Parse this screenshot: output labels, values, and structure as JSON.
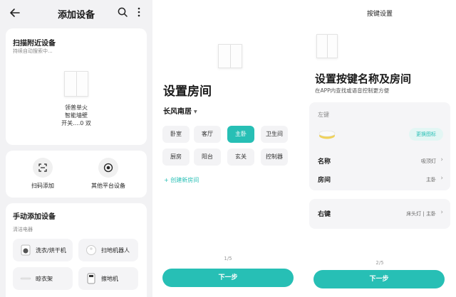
{
  "colors": {
    "accent": "#27bfb5",
    "card_bg": "#ffffff",
    "page_bg": "#f2f2f4"
  },
  "panel1": {
    "title": "添加设备",
    "icons": [
      "back-arrow-icon",
      "search-icon",
      "more-vertical-icon"
    ],
    "scan": {
      "title": "扫描附近设备",
      "subtitle": "持续自动搜索中...",
      "device_line1": "领普单火",
      "device_line2": "智能墙壁",
      "device_line3": "开关....0 双"
    },
    "actions": [
      {
        "label": "扫码添加",
        "icon": "scan-icon"
      },
      {
        "label": "其他平台设备",
        "icon": "target-icon"
      }
    ],
    "manual": {
      "title": "手动添加设备",
      "category": "清洁电器",
      "devices": [
        {
          "label": "洗衣/烘干机",
          "icon": "washer-icon"
        },
        {
          "label": "扫地机器人",
          "icon": "robot-vacuum-icon"
        },
        {
          "label": "晾衣架",
          "icon": "clothes-rack-icon"
        },
        {
          "label": "擦地机",
          "icon": "floor-mop-icon"
        }
      ]
    }
  },
  "panel2": {
    "title": "设置房间",
    "home": "长风南居",
    "rooms": [
      {
        "label": "卧室",
        "selected": false
      },
      {
        "label": "客厅",
        "selected": false
      },
      {
        "label": "主卧",
        "selected": true
      },
      {
        "label": "卫生间",
        "selected": false
      },
      {
        "label": "厨房",
        "selected": false
      },
      {
        "label": "阳台",
        "selected": false
      },
      {
        "label": "玄关",
        "selected": false
      },
      {
        "label": "控制器",
        "selected": false
      }
    ],
    "create_room": "+ 创建新房间",
    "pager": "1/5",
    "next": "下一步"
  },
  "panel3": {
    "title": "按键设置",
    "heading": "设置按键名称及房间",
    "desc": "在APP内查找或语音控制更方便",
    "left_key": {
      "label": "左键",
      "change_icon": "更换图标",
      "name_key": "名称",
      "name_value": "吸顶灯",
      "room_key": "房间",
      "room_value": "主卧"
    },
    "right_key": {
      "label": "右键",
      "value": "床头灯 | 主卧"
    },
    "pager": "2/5",
    "next": "下一步"
  }
}
